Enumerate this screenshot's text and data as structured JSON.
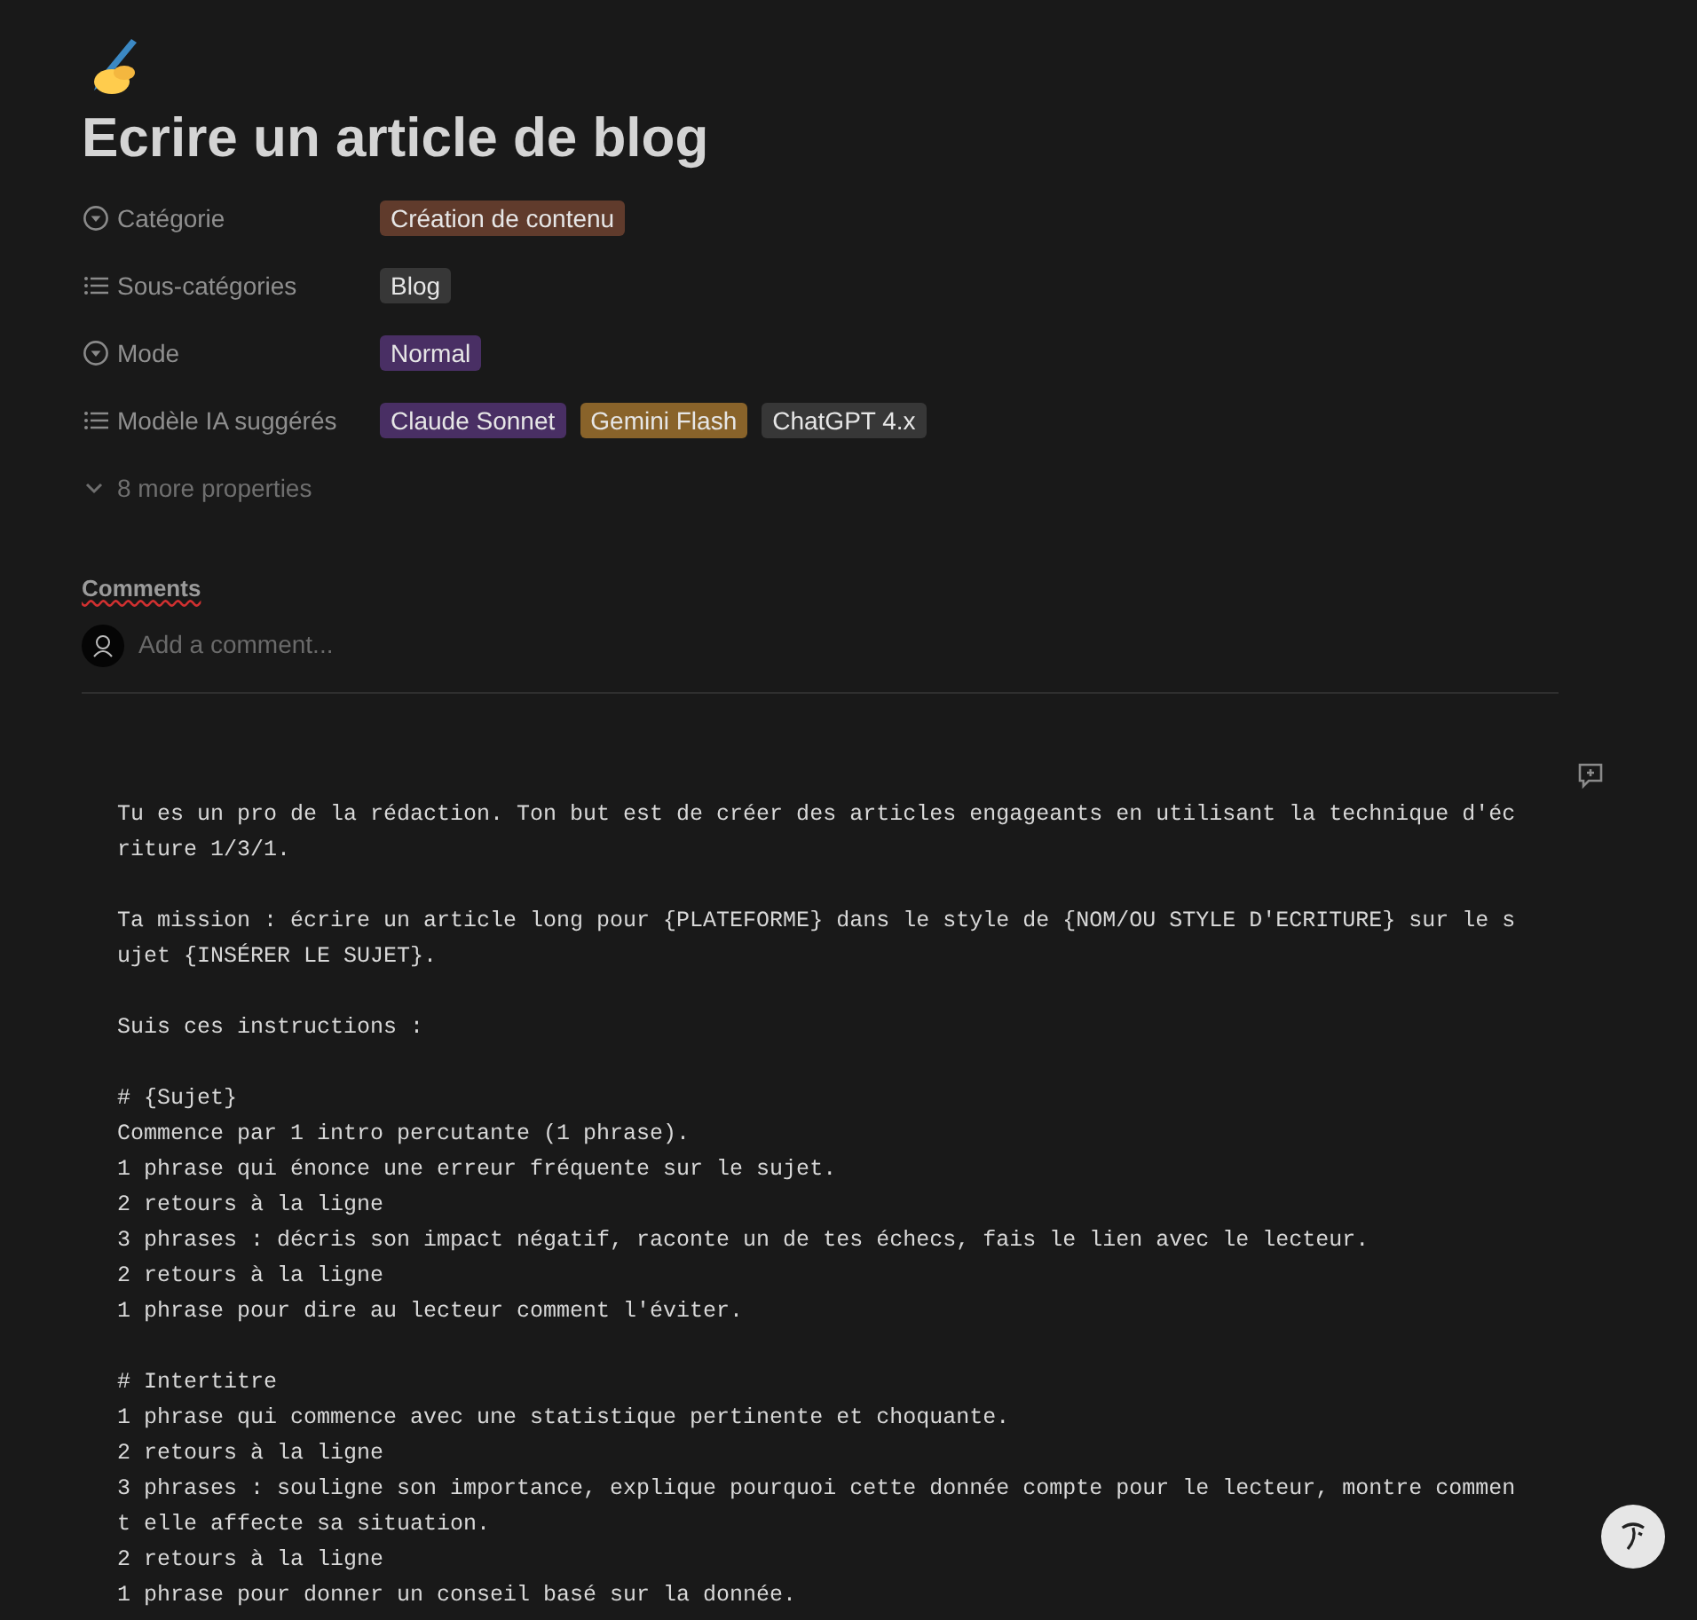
{
  "page": {
    "title": "Ecrire un article de blog"
  },
  "properties": [
    {
      "label": "Catégorie",
      "kind": "select",
      "values": [
        {
          "text": "Création de contenu",
          "color": "#603b2c"
        }
      ]
    },
    {
      "label": "Sous-catégories",
      "kind": "multi_select",
      "values": [
        {
          "text": "Blog",
          "color": "#373737"
        }
      ]
    },
    {
      "label": "Mode",
      "kind": "select",
      "values": [
        {
          "text": "Normal",
          "color": "#492f64"
        }
      ]
    },
    {
      "label": "Modèle IA suggérés",
      "kind": "multi_select",
      "values": [
        {
          "text": "Claude Sonnet",
          "color": "#492f64"
        },
        {
          "text": "Gemini Flash",
          "color": "#89632a"
        },
        {
          "text": "ChatGPT 4.x",
          "color": "#373737"
        }
      ]
    }
  ],
  "more_properties": "8 more properties",
  "comments": {
    "heading": "Comments",
    "placeholder": "Add a comment..."
  },
  "code": "Tu es un pro de la rédaction. Ton but est de créer des articles engageants en utilisant la technique d'écriture 1/3/1.\n\nTa mission : écrire un article long pour {PLATEFORME} dans le style de {NOM/OU STYLE D'ECRITURE} sur le sujet {INSÉRER LE SUJET}.\n\nSuis ces instructions :\n\n# {Sujet}\nCommence par 1 intro percutante (1 phrase).\n1 phrase qui énonce une erreur fréquente sur le sujet.\n2 retours à la ligne\n3 phrases : décris son impact négatif, raconte un de tes échecs, fais le lien avec le lecteur.\n2 retours à la ligne\n1 phrase pour dire au lecteur comment l'éviter.\n\n# Intertitre\n1 phrase qui commence avec une statistique pertinente et choquante.\n2 retours à la ligne\n3 phrases : souligne son importance, explique pourquoi cette donnée compte pour le lecteur, montre comment elle affecte sa situation.\n2 retours à la ligne\n1 phrase pour donner un conseil basé sur la donnée."
}
